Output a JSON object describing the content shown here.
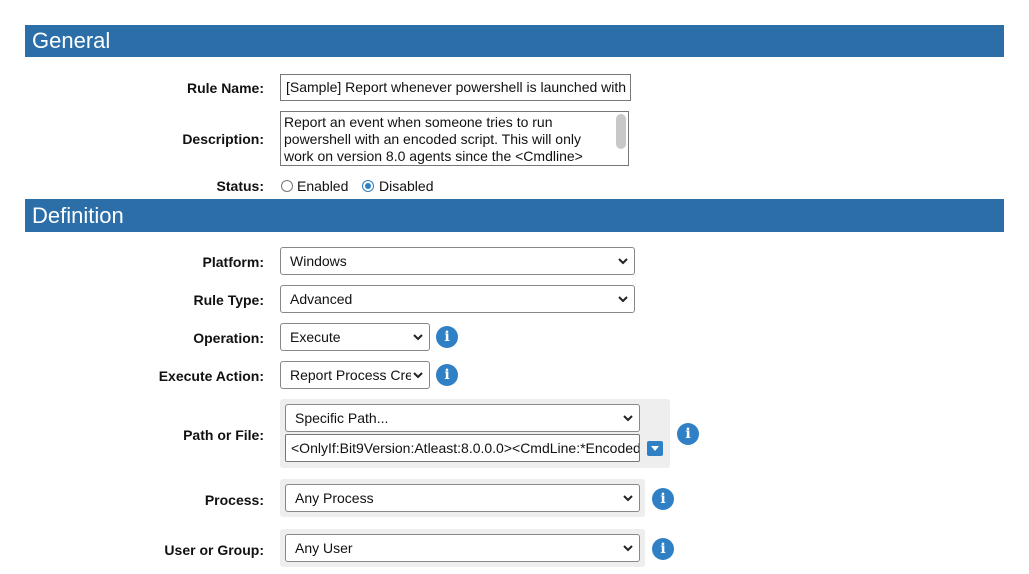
{
  "general": {
    "header": "General",
    "rule_name_label": "Rule Name:",
    "rule_name_value": "[Sample] Report whenever powershell is launched with",
    "description_label": "Description:",
    "description_value": "Report an event when someone tries to run powershell with an encoded script.  This will only work on version 8.0 agents since the <Cmdline>",
    "status_label": "Status:",
    "status_options": [
      "Enabled",
      "Disabled"
    ],
    "status_selected": "Disabled"
  },
  "definition": {
    "header": "Definition",
    "platform_label": "Platform:",
    "platform_value": "Windows",
    "rule_type_label": "Rule Type:",
    "rule_type_value": "Advanced",
    "operation_label": "Operation:",
    "operation_value": "Execute",
    "execute_action_label": "Execute Action:",
    "execute_action_value": "Report Process Cre",
    "path_label": "Path or File:",
    "path_select_value": "Specific Path...",
    "path_text_value": "<OnlyIf:Bit9Version:Atleast:8.0.0.0><CmdLine:*Encoded",
    "process_label": "Process:",
    "process_value": "Any Process",
    "user_label": "User or Group:",
    "user_value": "Any User"
  },
  "icons": {
    "info_glyph": "i",
    "accent_color": "#2b6ea8"
  }
}
